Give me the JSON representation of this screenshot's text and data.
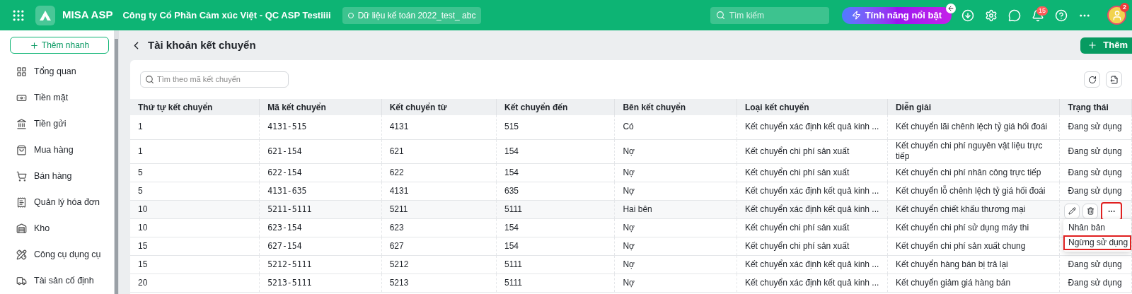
{
  "topbar": {
    "app_name": "MISA ASP",
    "company": "Công ty Cổ Phần Cảm xúc Việt - QC ASP Testiiii",
    "database": "Dữ liệu kế toán 2022_test_ abc",
    "search": {
      "placeholder": "Tìm kiếm"
    },
    "feature_button": "Tính năng nổi bật",
    "notification_count": "15",
    "avatar_badge": "2"
  },
  "sidebar": {
    "quick_add": "Thêm nhanh",
    "items": [
      {
        "kind": "overview",
        "label": "Tổng quan"
      },
      {
        "kind": "cash",
        "label": "Tiền mặt"
      },
      {
        "kind": "bank",
        "label": "Tiền gửi"
      },
      {
        "kind": "purchase",
        "label": "Mua hàng"
      },
      {
        "kind": "sales",
        "label": "Bán hàng"
      },
      {
        "kind": "invoice",
        "label": "Quản lý hóa đơn"
      },
      {
        "kind": "warehouse",
        "label": "Kho"
      },
      {
        "kind": "tools",
        "label": "Công cụ dụng cụ"
      },
      {
        "kind": "assets",
        "label": "Tài sản cố định"
      }
    ]
  },
  "page": {
    "title": "Tài khoản kết chuyển",
    "add_button": "Thêm",
    "search": {
      "placeholder": "Tìm theo mã kết chuyển"
    }
  },
  "table": {
    "columns": [
      "Thứ tự kết chuyển",
      "Mã kết chuyển",
      "Kết chuyển từ",
      "Kết chuyển đến",
      "Bên kết chuyển",
      "Loại kết chuyển",
      "Diễn giải",
      "Trạng thái"
    ],
    "rows": [
      {
        "cells": [
          "1",
          "4131-515",
          "4131",
          "515",
          "Có",
          "Kết chuyển xác định kết quả kinh ...",
          "Kết chuyển lãi chênh lệch tỷ giá hối đoái",
          "Đang sử dụng"
        ],
        "hovered": false
      },
      {
        "cells": [
          "1",
          "621-154",
          "621",
          "154",
          "Nợ",
          "Kết chuyển chi phí sản xuất",
          "Kết chuyển chi phí nguyên vật liệu trực tiếp",
          "Đang sử dụng"
        ],
        "hovered": false
      },
      {
        "cells": [
          "5",
          "622-154",
          "622",
          "154",
          "Nợ",
          "Kết chuyển chi phí sản xuất",
          "Kết chuyển chi phí nhân công trực tiếp",
          "Đang sử dụng"
        ],
        "hovered": false
      },
      {
        "cells": [
          "5",
          "4131-635",
          "4131",
          "635",
          "Nợ",
          "Kết chuyển xác định kết quả kinh ...",
          "Kết chuyển lỗ chênh lệch tỷ giá hối đoái",
          "Đang sử dụng"
        ],
        "hovered": false
      },
      {
        "cells": [
          "10",
          "5211-5111",
          "5211",
          "5111",
          "Hai bên",
          "Kết chuyển xác định kết quả kinh ...",
          "Kết chuyển chiết khấu thương mại"
        ],
        "hovered": true
      },
      {
        "cells": [
          "10",
          "623-154",
          "623",
          "154",
          "Nợ",
          "Kết chuyển chi phí sản xuất",
          "Kết chuyển chi phí sử dụng máy thi"
        ],
        "hovered": false
      },
      {
        "cells": [
          "15",
          "627-154",
          "627",
          "154",
          "Nợ",
          "Kết chuyển chi phí sản xuất",
          "Kết chuyển chi phí sản xuất chung"
        ],
        "hovered": false
      },
      {
        "cells": [
          "15",
          "5212-5111",
          "5212",
          "5111",
          "Nợ",
          "Kết chuyển xác định kết quả kinh ...",
          "Kết chuyển hàng bán bị trả lại",
          "Đang sử dụng"
        ],
        "hovered": false
      },
      {
        "cells": [
          "20",
          "5213-5111",
          "5213",
          "5111",
          "Nợ",
          "Kết chuyển xác định kết quả kinh ...",
          "Kết chuyển giảm giá hàng bán",
          "Đang sử dụng"
        ],
        "hovered": false
      }
    ]
  },
  "row_menu": {
    "more_highlighted": true,
    "items": [
      {
        "label": "Nhân bản",
        "highlighted": false
      },
      {
        "label": "Ngừng sử dụng",
        "highlighted": true
      }
    ]
  }
}
